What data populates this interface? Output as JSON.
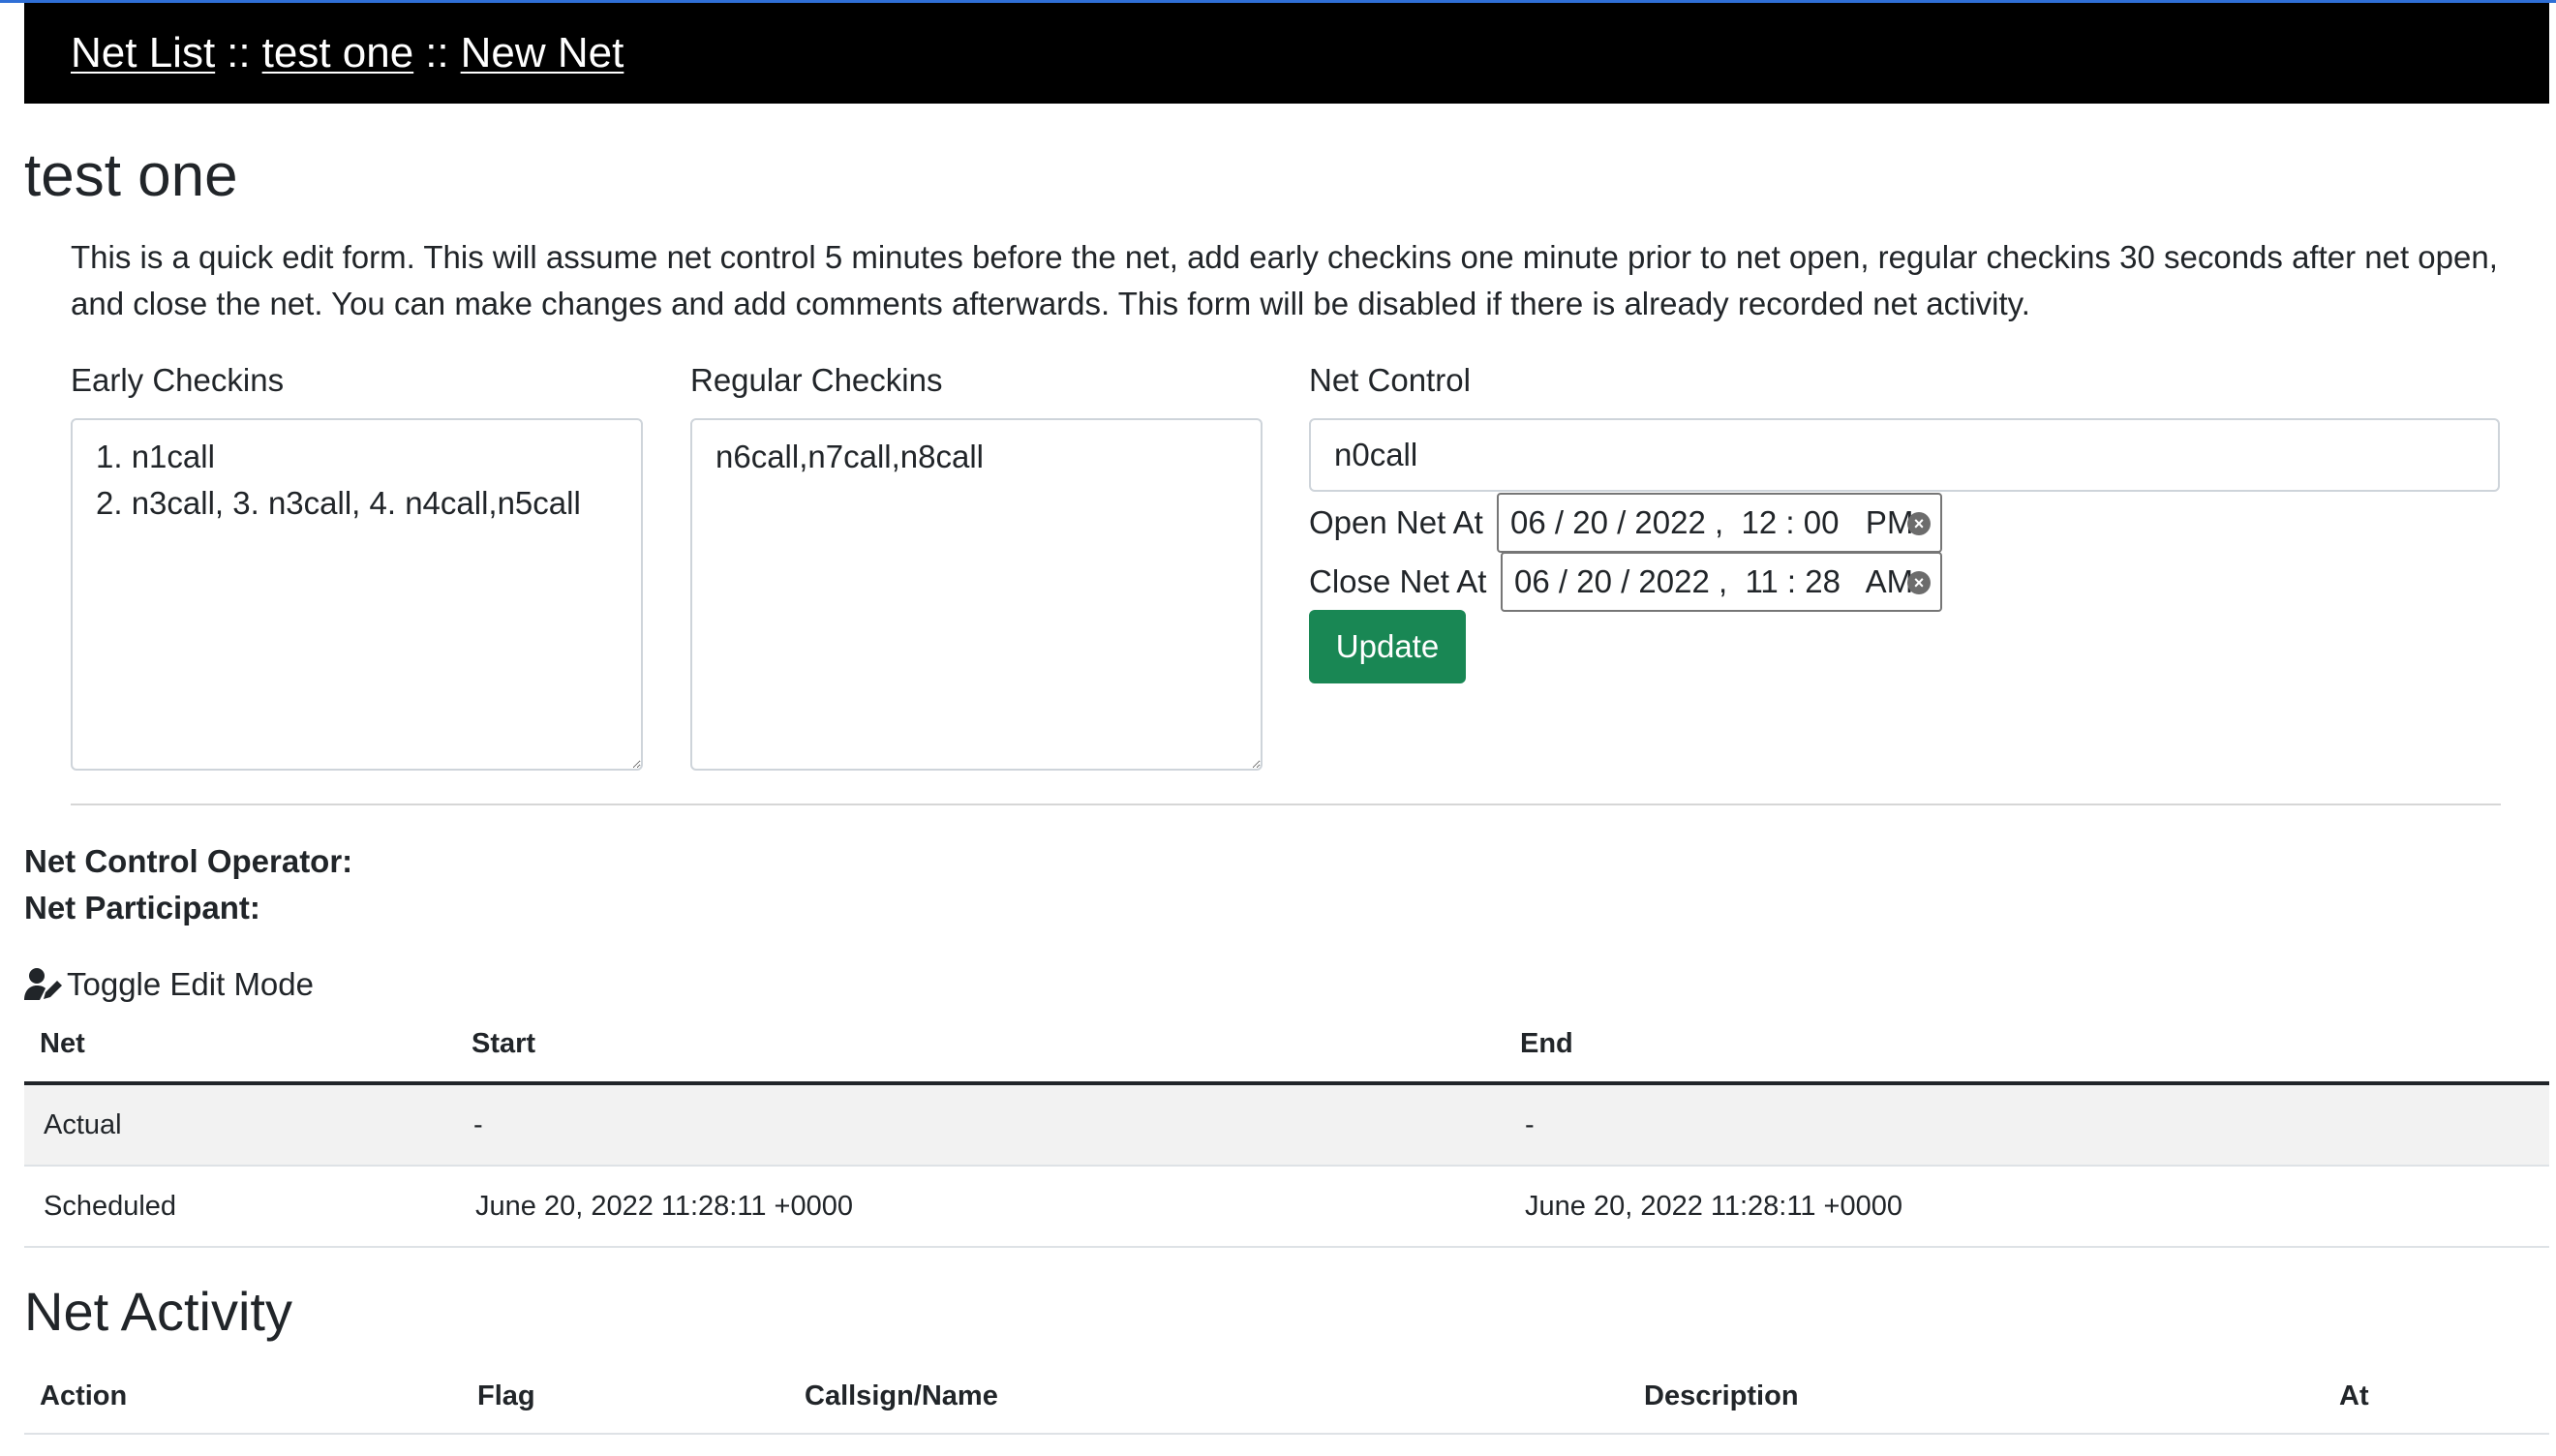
{
  "nav": {
    "net_list": "Net List",
    "separator": "::",
    "test_one": "test one",
    "new_net": "New Net"
  },
  "page_title": "test one",
  "lead": "This is a quick edit form. This will assume net control 5 minutes before the net, add early checkins one minute prior to net open, regular checkins 30 seconds after net open, and close the net. You can make changes and add comments afterwards. This form will be disabled if there is already recorded net activity.",
  "form": {
    "early_label": "Early Checkins",
    "early_value": "1. n1call\n2. n3call, 3. n3call, 4. n4call,n5call",
    "regular_label": "Regular Checkins",
    "regular_value": "n6call,n7call,n8call",
    "control_label": "Net Control",
    "control_value": "n0call",
    "open_label": "Open Net At",
    "open_value": "06 / 20 / 2022 ,  12 : 00   PM",
    "close_label": "Close Net At",
    "close_value": "06 / 20 / 2022 ,  11 : 28   AM",
    "update_label": "Update"
  },
  "info": {
    "operator_label": "Net Control Operator:",
    "participant_label": "Net Participant:"
  },
  "toggle_label": "Toggle Edit Mode",
  "times_table": {
    "headers": [
      "Net",
      "Start",
      "End"
    ],
    "rows": [
      [
        "Actual",
        "-",
        "-"
      ],
      [
        "Scheduled",
        "June 20, 2022 11:28:11 +0000",
        "June 20, 2022 11:28:11 +0000"
      ]
    ]
  },
  "activity": {
    "title": "Net Activity",
    "headers": [
      "Action",
      "Flag",
      "Callsign/Name",
      "Description",
      "At"
    ]
  },
  "colors": {
    "navbar_bg": "#000000",
    "update_button": "#198754",
    "striped_row": "#f2f2f2"
  }
}
